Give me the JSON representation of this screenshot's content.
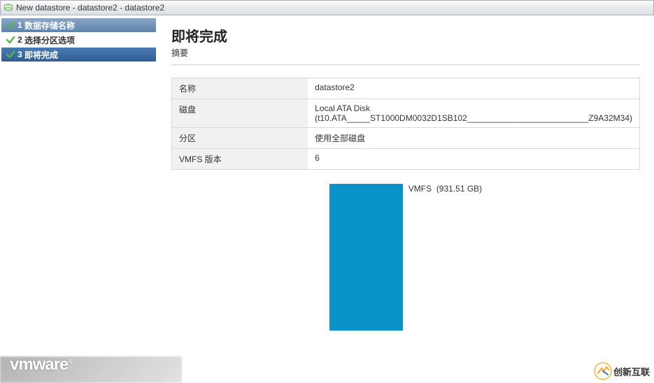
{
  "window": {
    "title": "New datastore - datastore2 - datastore2"
  },
  "wizard": {
    "steps": [
      {
        "num": "1",
        "label": "数据存储名称"
      },
      {
        "num": "2",
        "label": "选择分区选项"
      },
      {
        "num": "3",
        "label": "即将完成"
      }
    ]
  },
  "main": {
    "title": "即将完成",
    "subtitle": "摘要",
    "rows": [
      {
        "label": "名称",
        "value": "datastore2"
      },
      {
        "label": "磁盘",
        "value": "Local ATA Disk (t10.ATA_____ST1000DM0032D1SB102__________________________Z9A32M34)"
      },
      {
        "label": "分区",
        "value": "使用全部磁盘"
      },
      {
        "label": "VMFS 版本",
        "value": "6"
      }
    ],
    "disk": {
      "label": "VMFS",
      "size": "(931.51 GB)"
    }
  },
  "branding": {
    "logo_text": "vmware",
    "tm": "®"
  },
  "watermark": {
    "text": "创新互联"
  }
}
